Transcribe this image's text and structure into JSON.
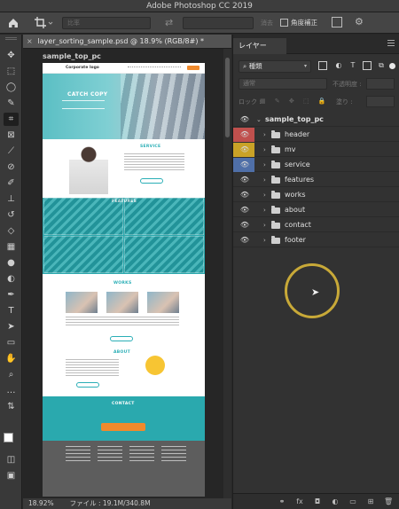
{
  "window": {
    "title": "Adobe Photoshop CC 2019"
  },
  "options_bar": {
    "ratio_placeholder": "比率",
    "clear_label": "消去",
    "straighten_label": "角度補正",
    "icons": [
      "home-icon",
      "crop-icon",
      "swap-icon",
      "grid-overlay-icon",
      "gear-icon"
    ]
  },
  "tools": {
    "items": [
      "move",
      "artboard",
      "marquee",
      "lasso",
      "quick-select",
      "crop",
      "frame",
      "eyedropper",
      "spot-heal",
      "brush",
      "clone-stamp",
      "history-brush",
      "eraser",
      "gradient",
      "blur",
      "dodge",
      "pen",
      "type",
      "path-select",
      "rectangle",
      "hand",
      "zoom",
      "more"
    ],
    "active": "crop"
  },
  "document": {
    "tab_title": "layer_sorting_sample.psd @ 18.9% (RGB/8#) *",
    "artboard_name": "sample_top_pc",
    "zoom": "18.92%",
    "file_info": "ファイル : 19.1M/340.8M",
    "mock": {
      "logo": "Corporate logo",
      "catch": "CATCH COPY",
      "service": "SERVICE",
      "features": "FEATURES",
      "works": "WORKS",
      "about": "ABOUT",
      "contact": "CONTACT"
    }
  },
  "layers_panel": {
    "tab_label": "レイヤー",
    "filter_kind": "種類",
    "blend_mode": "通常",
    "opacity_label": "不透明度 :",
    "lock_label": "ロック :",
    "fill_label": "塗り :",
    "artboard": "sample_top_pc",
    "layers": [
      {
        "name": "header",
        "color": "#c0504d"
      },
      {
        "name": "mv",
        "color": "#c9a227"
      },
      {
        "name": "service",
        "color": "#4f6fa8"
      },
      {
        "name": "features",
        "color": ""
      },
      {
        "name": "works",
        "color": ""
      },
      {
        "name": "about",
        "color": ""
      },
      {
        "name": "contact",
        "color": ""
      },
      {
        "name": "footer",
        "color": ""
      }
    ]
  },
  "colors": {
    "accent_teal": "#2aa9ae",
    "cta_orange": "#f08a2c",
    "cursor_ring": "#c8a938"
  }
}
